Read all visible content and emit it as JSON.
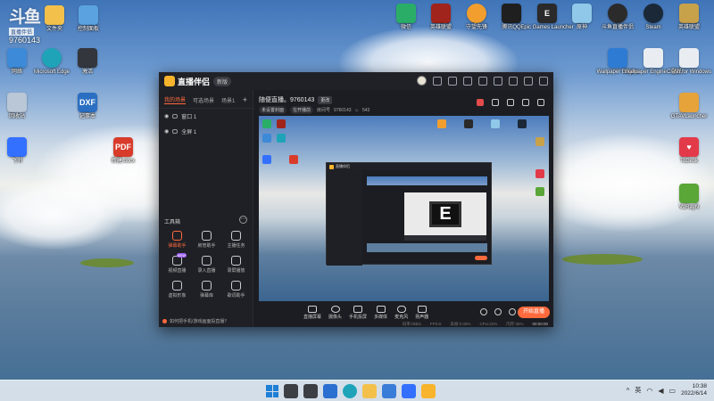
{
  "watermark": {
    "logo": "斗鱼",
    "sub": "直播伴侣",
    "room_id": "9760143"
  },
  "desktop_left": [
    {
      "label": "文件夹",
      "icon": "folder-icon",
      "color": "#f3c14b"
    },
    {
      "label": "控制面板",
      "icon": "control-panel-icon",
      "color": "#5aa3e0"
    },
    {
      "label": "网络",
      "icon": "network-icon",
      "color": "#3d8ad8"
    },
    {
      "label": "Microsoft Edge",
      "icon": "edge-icon",
      "color": "#1fa3b8"
    },
    {
      "label": "激活",
      "icon": "monitor-icon",
      "color": "#33363c"
    },
    {
      "label": "回收站",
      "icon": "recycle-bin-icon",
      "color": "#b9c7d6"
    },
    {
      "label": "记事本",
      "icon": "dxf-file-icon",
      "color": "#2a6fc2"
    },
    {
      "label": "飞书",
      "icon": "feishu-icon",
      "color": "#3370ff"
    },
    {
      "label": "新建.docx",
      "icon": "pdf-file-icon",
      "color": "#d93b2b"
    }
  ],
  "desktop_right": [
    {
      "label": "微信",
      "icon": "wechat-icon",
      "color": "#2aae67"
    },
    {
      "label": "英雄联盟",
      "icon": "game-icon",
      "color": "#a0241b"
    },
    {
      "label": "守望先锋",
      "icon": "overwatch-icon",
      "color": "#f29e2e"
    },
    {
      "label": "腾讯QQ",
      "icon": "qq-icon",
      "color": "#1f1f1f"
    },
    {
      "label": "Epic Games Launcher",
      "icon": "epic-icon",
      "color": "#2a2a2a"
    },
    {
      "label": "原神",
      "icon": "genshin-icon",
      "color": "#8fc8e8"
    },
    {
      "label": "斗鱼直播伴侣",
      "icon": "obs-icon",
      "color": "#2b2b2b"
    },
    {
      "label": "Steam",
      "icon": "steam-icon",
      "color": "#1b2838"
    },
    {
      "label": "英雄联盟",
      "icon": "lol-icon",
      "color": "#c8a24a"
    },
    {
      "label": "Wallpaper Engine",
      "icon": "wallpaper-icon",
      "color": "#2e7bd3"
    },
    {
      "label": "Wallpaper Engine · 壁纸",
      "icon": "file-icon",
      "color": "#e9edf2"
    },
    {
      "label": "Clash for Windows",
      "icon": "file-icon",
      "color": "#e9edf2"
    },
    {
      "label": "GTAVLauncher",
      "icon": "gtav-icon",
      "color": "#e6a33a"
    },
    {
      "label": "ToDesk",
      "icon": "heart-icon",
      "color": "#e33a4a"
    },
    {
      "label": "V2RayN",
      "icon": "v2ray-icon",
      "color": "#5aa637"
    }
  ],
  "app": {
    "brand": "直播伴侣",
    "version": "新版",
    "tabs": [
      "我的场景",
      "可选场景",
      "场景1"
    ],
    "scenes": [
      "窗口 1",
      "全屏 1"
    ],
    "tools_title": "工具箱",
    "tools": [
      {
        "label": "弹幕助手",
        "icon": "danmaku-icon",
        "highlight": true,
        "badge": ""
      },
      {
        "label": "房管助手",
        "icon": "user-icon",
        "highlight": false,
        "badge": ""
      },
      {
        "label": "主播任务",
        "icon": "task-icon",
        "highlight": false,
        "badge": ""
      },
      {
        "label": "视频直播",
        "icon": "video-icon",
        "highlight": false,
        "badge": "NEW"
      },
      {
        "label": "录入直播",
        "icon": "download-icon",
        "highlight": false,
        "badge": ""
      },
      {
        "label": "录屏播放",
        "icon": "record-icon",
        "highlight": false,
        "badge": ""
      },
      {
        "label": "虚拟形象",
        "icon": "avatar-icon",
        "highlight": false,
        "badge": ""
      },
      {
        "label": "弹幕库",
        "icon": "library-icon",
        "highlight": false,
        "badge": ""
      },
      {
        "label": "歌词助手",
        "icon": "lyrics-icon",
        "highlight": false,
        "badge": ""
      }
    ],
    "tip": "如何把手机/游戏画面投直播？",
    "room_title": "随便直播。9760143",
    "room_edit": "更改",
    "room_row2": [
      "未设置封面",
      "在开播前",
      "房间号",
      "9760143",
      "543"
    ],
    "controls": [
      "直播屏幕",
      "摄像头",
      "手机投屏",
      "多媒体",
      "麦克风",
      "扬声器"
    ],
    "go_live": "开始直播",
    "status": [
      "码率:0kb/s",
      "FPS:0",
      "丢帧:0.00%",
      "CPU:22%",
      "内存:35%"
    ],
    "timer": "00:00:00"
  },
  "taskbar": {
    "apps": [
      {
        "icon": "search-icon",
        "color": "#3c3f44"
      },
      {
        "icon": "task-view-icon",
        "color": "#3c3f44"
      },
      {
        "icon": "widgets-icon",
        "color": "#2b6fd1"
      },
      {
        "icon": "edge-icon",
        "color": "#1fa3b8"
      },
      {
        "icon": "explorer-icon",
        "color": "#f3c14b"
      },
      {
        "icon": "store-icon",
        "color": "#3a7dd8"
      },
      {
        "icon": "feishu-icon",
        "color": "#3370ff"
      },
      {
        "icon": "douyu-icon",
        "color": "#f7b42c"
      }
    ],
    "lang": "英",
    "time": "10:38",
    "date": "2022/6/14"
  }
}
